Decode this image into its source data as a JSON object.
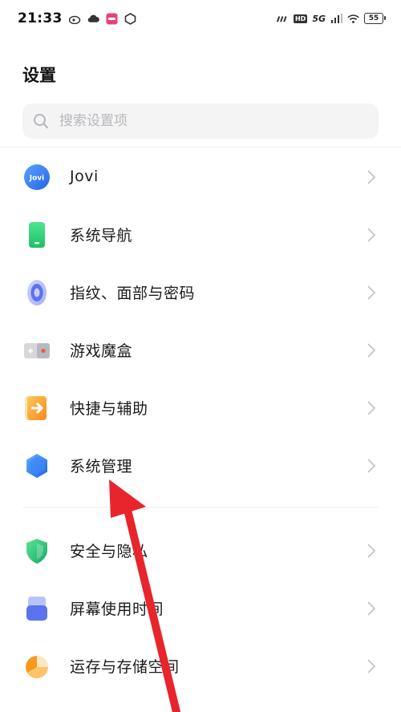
{
  "status_bar": {
    "time": "21:33",
    "network_label": "5G",
    "hd_label": "HD",
    "battery_level": "55"
  },
  "page": {
    "title": "设置"
  },
  "search": {
    "placeholder": "搜索设置项",
    "value": ""
  },
  "menu": {
    "items": [
      {
        "label": "Jovi",
        "icon": "jovi-icon",
        "color": "#3a7bf0"
      },
      {
        "label": "系统导航",
        "icon": "phone-navigation-icon",
        "color": "#2fd37a"
      },
      {
        "label": "指纹、面部与密码",
        "icon": "fingerprint-icon",
        "color": "#6a7ff5"
      },
      {
        "label": "游戏魔盒",
        "icon": "game-box-icon",
        "color": "#b9b9c0"
      },
      {
        "label": "快捷与辅助",
        "icon": "shortcut-icon",
        "color": "#f5a12a"
      },
      {
        "label": "系统管理",
        "icon": "system-management-icon",
        "color": "#2f7df0"
      },
      {
        "label": "安全与隐私",
        "icon": "shield-icon",
        "color": "#2bc27a"
      },
      {
        "label": "屏幕使用时间",
        "icon": "screen-time-icon",
        "color": "#5b73ec"
      },
      {
        "label": "运存与存储空间",
        "icon": "storage-pie-icon",
        "color": "#f5a62a"
      }
    ]
  },
  "annotation": {
    "arrow_color": "#e8252c"
  }
}
